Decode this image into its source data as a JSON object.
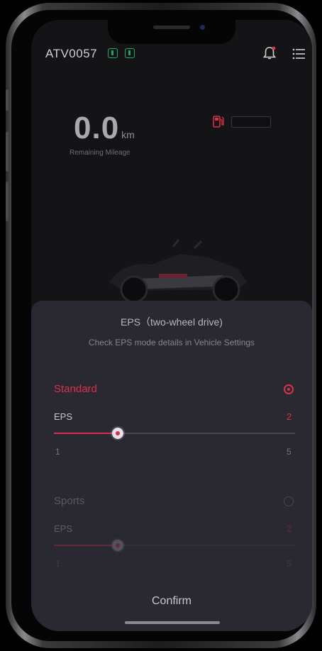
{
  "header": {
    "vehicle_id": "ATV0057",
    "icons": [
      "badge-icon",
      "badge-icon",
      "bell-icon",
      "menu-icon"
    ]
  },
  "dashboard": {
    "mileage_value": "0.0",
    "mileage_unit": "km",
    "mileage_label": "Remaining Mileage",
    "fuel_level": 0
  },
  "sheet": {
    "title": "EPS（two-wheel drive)",
    "subtitle": "Check EPS mode details in Vehicle Settings",
    "options": [
      {
        "name": "Standard",
        "selected": true,
        "param_label": "EPS",
        "value": "2",
        "min": "1",
        "max": "5"
      },
      {
        "name": "Sports",
        "selected": false,
        "param_label": "EPS",
        "value": "2",
        "min": "1",
        "max": "5"
      }
    ],
    "confirm_label": "Confirm"
  },
  "colors": {
    "accent": "#d8324a",
    "sheet_bg": "#2a2830",
    "screen_bg": "#141417",
    "badge": "#1fa86a"
  }
}
